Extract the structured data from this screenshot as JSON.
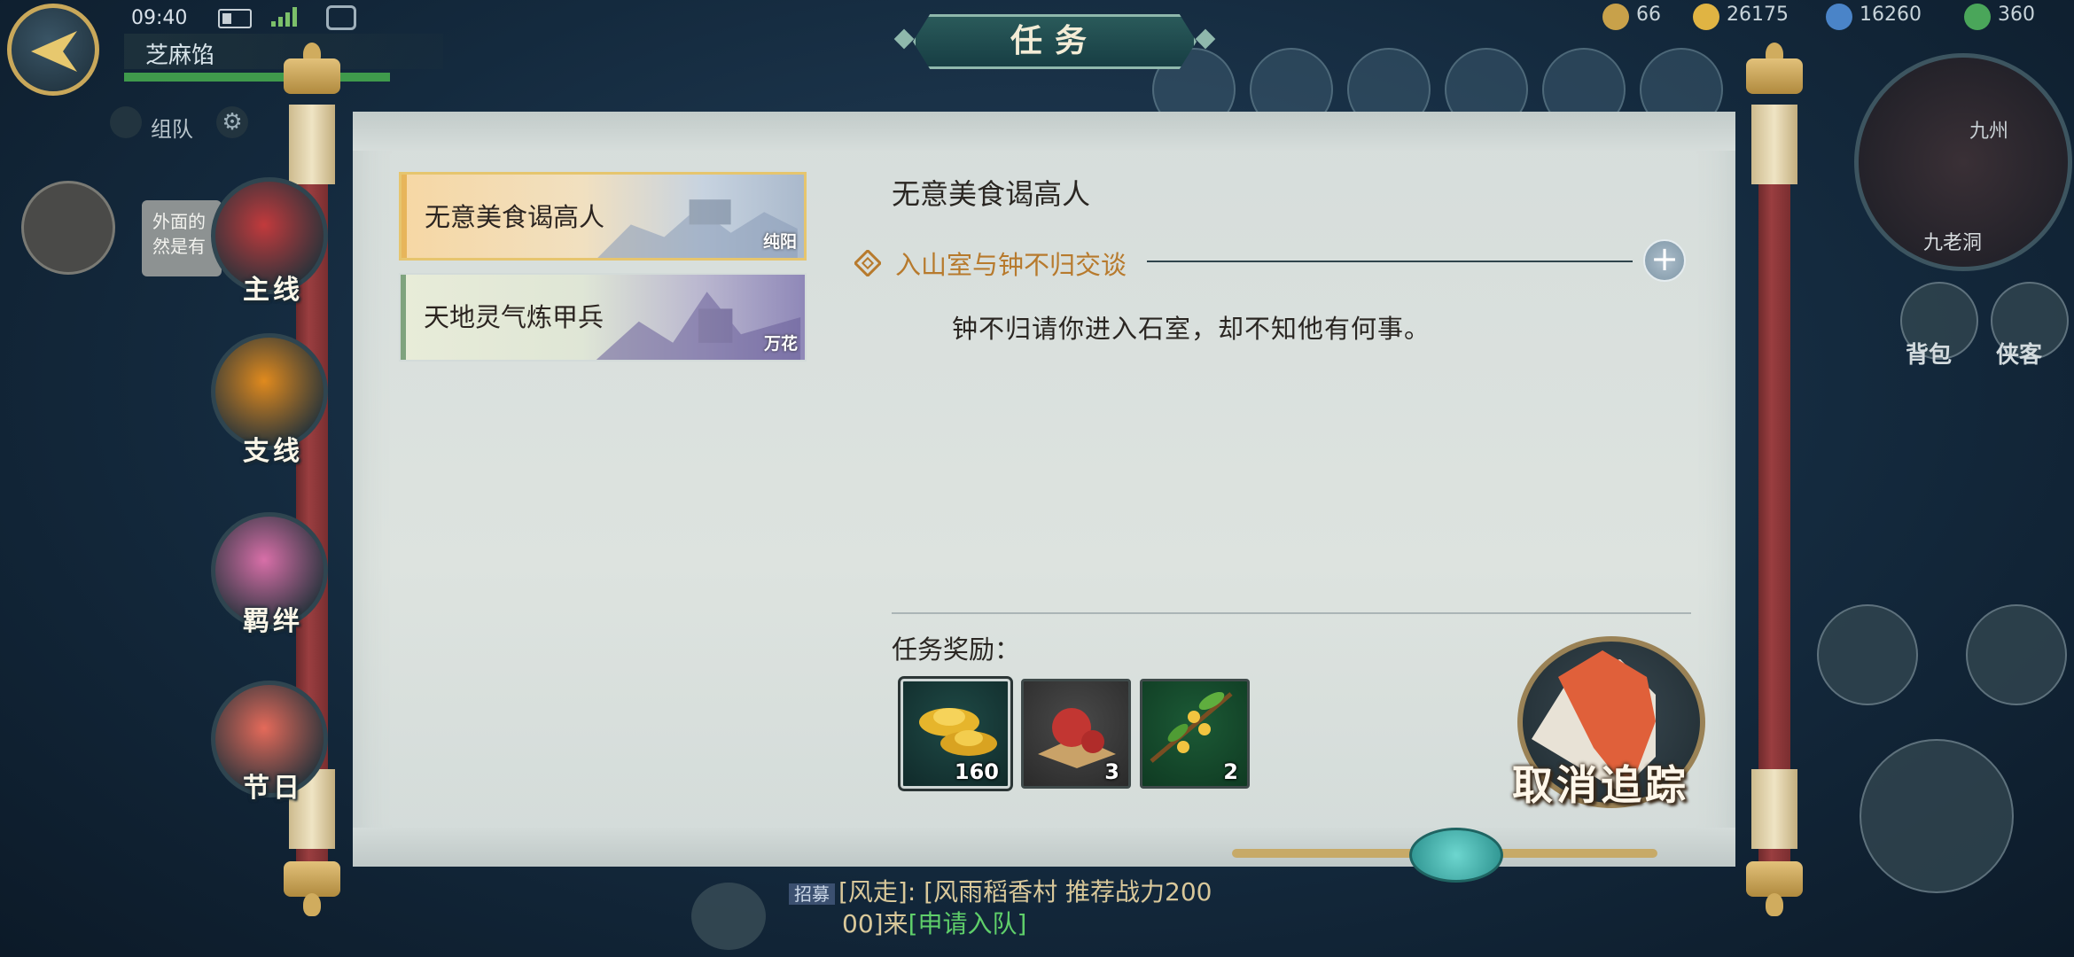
{
  "status": {
    "time": "09:40"
  },
  "player": {
    "name": "芝麻馅"
  },
  "hud": {
    "team_label": "组队",
    "resources": [
      {
        "icon": "ingot-icon",
        "value": "66"
      },
      {
        "icon": "gold-coin-icon",
        "value": "26175"
      },
      {
        "icon": "jade-coin-icon",
        "value": "16260"
      },
      {
        "icon": "stamina-icon",
        "value": "360"
      }
    ],
    "minimap": {
      "location": "九老洞",
      "region": "九州"
    },
    "side_buttons": [
      "背包",
      "侠客"
    ]
  },
  "window": {
    "title": "任务"
  },
  "categories": [
    {
      "id": "main",
      "label": "主线",
      "color": "#c23a3c"
    },
    {
      "id": "side",
      "label": "支线",
      "color": "#e08a1e"
    },
    {
      "id": "bond",
      "label": "羁绊",
      "color": "#d86fa8"
    },
    {
      "id": "festival",
      "label": "节日",
      "color": "#e46a5a"
    }
  ],
  "quests": [
    {
      "name": "无意美食谒高人",
      "tag": "纯阳",
      "selected": true
    },
    {
      "name": "天地灵气炼甲兵",
      "tag": "万花",
      "selected": false
    }
  ],
  "detail": {
    "title": "无意美食谒高人",
    "objective": "入山室与钟不归交谈",
    "description": "钟不归请你进入石室，却不知他有何事。",
    "rewards_title": "任务奖励：",
    "rewards": [
      {
        "icon": "gold-ingot-icon",
        "count": "160"
      },
      {
        "icon": "red-beans-icon",
        "count": "3"
      },
      {
        "icon": "osmanthus-icon",
        "count": "2"
      }
    ],
    "cancel_tracking": "取消追踪"
  },
  "npc_chat": {
    "text": [
      "外面的",
      "然是有"
    ]
  },
  "bottom_chat": {
    "channel": "招募",
    "line1": "[风走]: [风雨稻香村 推荐战力200",
    "line2_prefix": "00]来",
    "apply": "[申请入队]"
  }
}
